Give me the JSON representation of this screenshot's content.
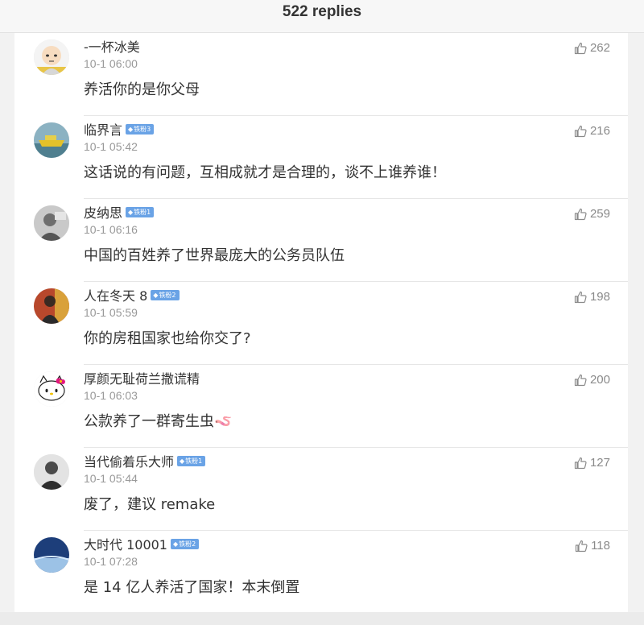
{
  "header": {
    "title": "522 replies"
  },
  "comments": [
    {
      "username": "-一杯冰美",
      "badge": "",
      "timestamp": "10-1 06:00",
      "text": "养活你的是你父母",
      "likes": "262",
      "avatar_icon": "bald-hero-avatar-icon"
    },
    {
      "username": "临界言",
      "badge": "铁粉3",
      "timestamp": "10-1 05:42",
      "text": "这话说的有问题，互相成就才是合理的，谈不上谁养谁！",
      "likes": "216",
      "avatar_icon": "yellow-boat-avatar-icon"
    },
    {
      "username": "皮纳思",
      "badge": "铁粉1",
      "timestamp": "10-1 06:16",
      "text": "中国的百姓养了世界最庞大的公务员队伍",
      "likes": "259",
      "avatar_icon": "grey-photo-avatar-icon"
    },
    {
      "username": "人在冬天 8",
      "badge": "铁粉2",
      "timestamp": "10-1 05:59",
      "text": "你的房租国家也给你交了?",
      "likes": "198",
      "avatar_icon": "person-photo-avatar-icon"
    },
    {
      "username": "厚颜无耻荷兰撒谎精",
      "badge": "",
      "timestamp": "10-1 06:03",
      "text": "公款养了一群寄生虫",
      "emoji": "🪱",
      "likes": "200",
      "avatar_icon": "hello-kitty-avatar-icon"
    },
    {
      "username": "当代偷着乐大师",
      "badge": "铁粉1",
      "timestamp": "10-1 05:44",
      "text": "废了，建议 remake",
      "likes": "127",
      "avatar_icon": "man-photo-avatar-icon"
    },
    {
      "username": "大时代 10001",
      "badge": "铁粉2",
      "timestamp": "10-1 07:28",
      "text": "是 14 亿人养活了国家！本末倒置",
      "likes": "118",
      "avatar_icon": "earth-avatar-icon"
    }
  ]
}
